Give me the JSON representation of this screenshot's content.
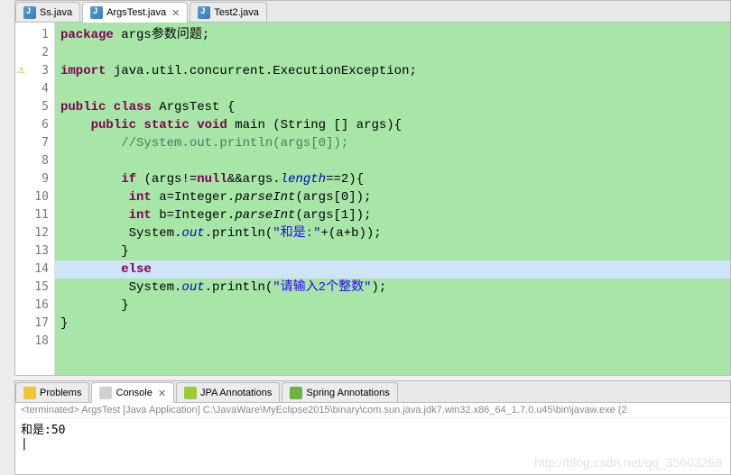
{
  "tabs": [
    {
      "label": "Ss.java",
      "active": false
    },
    {
      "label": "ArgsTest.java",
      "active": true
    },
    {
      "label": "Test2.java",
      "active": false
    }
  ],
  "gutter_marks": {
    "3": "⚠"
  },
  "code": {
    "lines": [
      {
        "n": 1,
        "tokens": [
          {
            "t": "package ",
            "c": "kw"
          },
          {
            "t": "args参数问题;",
            "c": ""
          }
        ]
      },
      {
        "n": 2,
        "tokens": []
      },
      {
        "n": 3,
        "tokens": [
          {
            "t": "import ",
            "c": "kw"
          },
          {
            "t": "java.util.concurrent.ExecutionException;",
            "c": ""
          }
        ]
      },
      {
        "n": 4,
        "tokens": []
      },
      {
        "n": 5,
        "tokens": [
          {
            "t": "public class ",
            "c": "kw"
          },
          {
            "t": "ArgsTest {",
            "c": ""
          }
        ]
      },
      {
        "n": 6,
        "tokens": [
          {
            "t": "    ",
            "c": ""
          },
          {
            "t": "public static void ",
            "c": "kw"
          },
          {
            "t": "main (String [] args){",
            "c": ""
          }
        ]
      },
      {
        "n": 7,
        "tokens": [
          {
            "t": "        ",
            "c": ""
          },
          {
            "t": "//System.out.println(args[0]);",
            "c": "com"
          }
        ]
      },
      {
        "n": 8,
        "tokens": []
      },
      {
        "n": 9,
        "tokens": [
          {
            "t": "        ",
            "c": ""
          },
          {
            "t": "if ",
            "c": "kw"
          },
          {
            "t": "(args!=",
            "c": ""
          },
          {
            "t": "null",
            "c": "kw"
          },
          {
            "t": "&&args.",
            "c": ""
          },
          {
            "t": "length",
            "c": "fld"
          },
          {
            "t": "==2){",
            "c": ""
          }
        ]
      },
      {
        "n": 10,
        "tokens": [
          {
            "t": "         ",
            "c": ""
          },
          {
            "t": "int ",
            "c": "kw"
          },
          {
            "t": "a=Integer.",
            "c": ""
          },
          {
            "t": "parseInt",
            "c": "mtd"
          },
          {
            "t": "(args[0]);",
            "c": ""
          }
        ]
      },
      {
        "n": 11,
        "tokens": [
          {
            "t": "         ",
            "c": ""
          },
          {
            "t": "int ",
            "c": "kw"
          },
          {
            "t": "b=Integer.",
            "c": ""
          },
          {
            "t": "parseInt",
            "c": "mtd"
          },
          {
            "t": "(args[1]);",
            "c": ""
          }
        ]
      },
      {
        "n": 12,
        "tokens": [
          {
            "t": "         System.",
            "c": ""
          },
          {
            "t": "out",
            "c": "fld"
          },
          {
            "t": ".println(",
            "c": ""
          },
          {
            "t": "\"和是:\"",
            "c": "str"
          },
          {
            "t": "+(a+b));",
            "c": ""
          }
        ]
      },
      {
        "n": 13,
        "tokens": [
          {
            "t": "        }",
            "c": ""
          }
        ]
      },
      {
        "n": 14,
        "hl": true,
        "tokens": [
          {
            "t": "        ",
            "c": ""
          },
          {
            "t": "else",
            "c": "kw"
          }
        ]
      },
      {
        "n": 15,
        "tokens": [
          {
            "t": "         System.",
            "c": ""
          },
          {
            "t": "out",
            "c": "fld"
          },
          {
            "t": ".println(",
            "c": ""
          },
          {
            "t": "\"请输入2个整数\"",
            "c": "str"
          },
          {
            "t": ");",
            "c": ""
          }
        ]
      },
      {
        "n": 16,
        "tokens": [
          {
            "t": "        }",
            "c": ""
          }
        ]
      },
      {
        "n": 17,
        "tokens": [
          {
            "t": "}",
            "c": ""
          }
        ]
      },
      {
        "n": 18,
        "tokens": []
      }
    ]
  },
  "console_tabs": [
    {
      "label": "Problems",
      "icon": "i-prob",
      "active": false
    },
    {
      "label": "Console",
      "icon": "i-cons",
      "active": true,
      "closable": true
    },
    {
      "label": "JPA Annotations",
      "icon": "i-jpa",
      "active": false
    },
    {
      "label": "Spring Annotations",
      "icon": "i-spring",
      "active": false
    }
  ],
  "console": {
    "header": "<terminated> ArgsTest [Java Application] C:\\JavaWare\\MyEclipse2015\\binary\\com.sun.java.jdk7.win32.x86_64_1.7.0.u45\\bin\\javaw.exe (2",
    "output": "和是:50"
  },
  "watermark": "http://blog.csdn.net/qq_35603268"
}
